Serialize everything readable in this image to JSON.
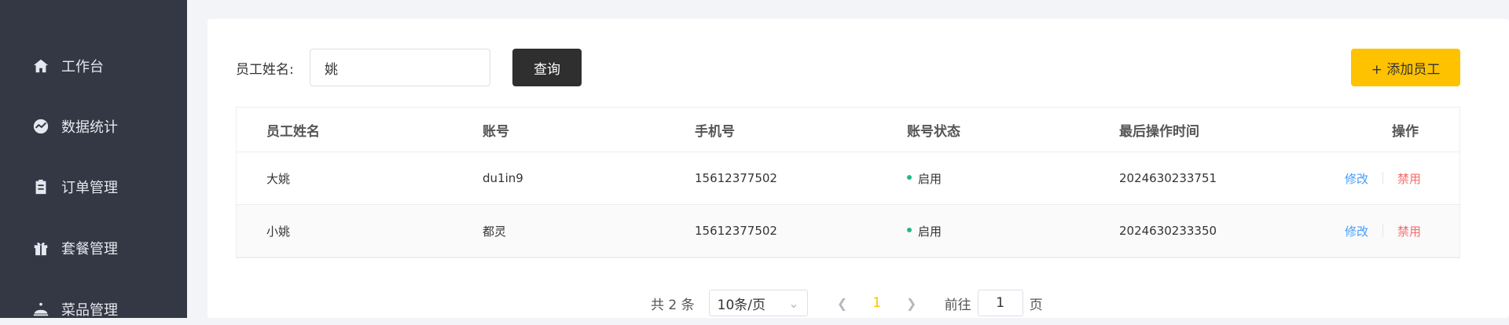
{
  "sidebar": {
    "items": [
      {
        "label": "工作台",
        "icon": "home-icon"
      },
      {
        "label": "数据统计",
        "icon": "chart-icon"
      },
      {
        "label": "订单管理",
        "icon": "clipboard-icon"
      },
      {
        "label": "套餐管理",
        "icon": "gift-icon"
      },
      {
        "label": "菜品管理",
        "icon": "dish-icon"
      }
    ]
  },
  "search": {
    "label": "员工姓名:",
    "value": "姚",
    "button": "查询"
  },
  "add_button": "+ 添加员工",
  "table": {
    "headers": [
      "员工姓名",
      "账号",
      "手机号",
      "账号状态",
      "最后操作时间",
      "操作"
    ],
    "rows": [
      {
        "name": "大姚",
        "account": "du1in9",
        "phone": "15612377502",
        "status": "启用",
        "time": "2024630233751",
        "edit": "修改",
        "disable": "禁用"
      },
      {
        "name": "小姚",
        "account": "都灵",
        "phone": "15612377502",
        "status": "启用",
        "time": "2024630233350",
        "edit": "修改",
        "disable": "禁用"
      }
    ]
  },
  "pagination": {
    "total": "共 2 条",
    "page_size": "10条/页",
    "current_page": "1",
    "goto_label": "前往",
    "goto_value": "1",
    "goto_unit": "页"
  },
  "colors": {
    "sidebar_bg": "#343744",
    "accent": "#ffc200",
    "query_button": "#2f2f2f",
    "edit_link": "#419eff",
    "disable_link": "#f56c6c",
    "status_dot": "#22bb7d"
  }
}
